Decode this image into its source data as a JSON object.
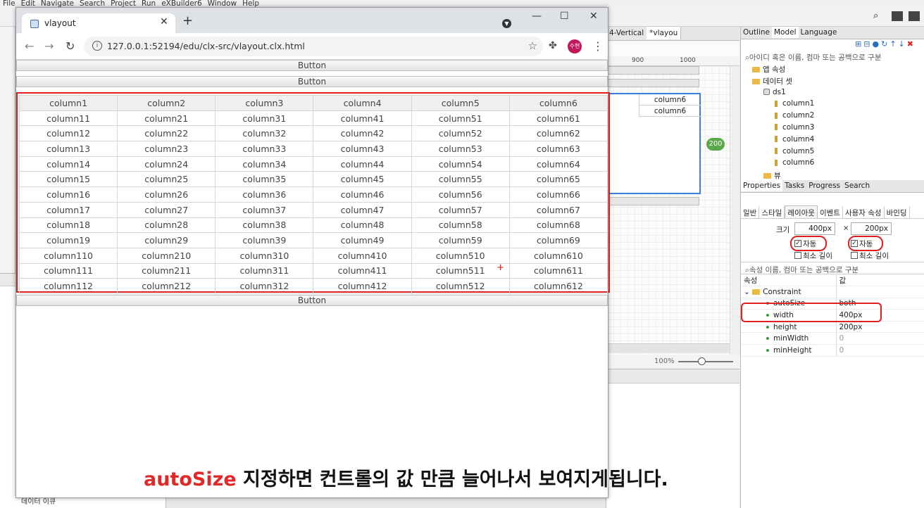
{
  "ide": {
    "menu": [
      "File",
      "Edit",
      "Navigate",
      "Search",
      "Project",
      "Run",
      "eXBuilder6",
      "Window",
      "Help"
    ],
    "editor_tabs": [
      "4-Vertical",
      "*vlayou"
    ],
    "ruler": [
      "900",
      "1000"
    ],
    "design_cells": [
      "column6",
      "column6"
    ],
    "size_badge": "200",
    "zoom": "100%",
    "left_panel_items": [
      "데이터 이큐"
    ],
    "right_top": {
      "tabs": [
        "Outline",
        "Model",
        "Language"
      ],
      "search_placeholder": "아이디 혹은 이름, 컴마 또는 공백으로 구분",
      "tree": [
        {
          "label": "앱 속성",
          "indent": 1,
          "kind": "folder"
        },
        {
          "label": "데이터 셋",
          "indent": 1,
          "kind": "folder"
        },
        {
          "label": "ds1",
          "indent": 2,
          "kind": "ds"
        },
        {
          "label": "column1",
          "indent": 3,
          "kind": "leaf"
        },
        {
          "label": "column2",
          "indent": 3,
          "kind": "leaf"
        },
        {
          "label": "column3",
          "indent": 3,
          "kind": "leaf"
        },
        {
          "label": "column4",
          "indent": 3,
          "kind": "leaf"
        },
        {
          "label": "column5",
          "indent": 3,
          "kind": "leaf"
        },
        {
          "label": "column6",
          "indent": 3,
          "kind": "leaf"
        },
        {
          "label": "뷰",
          "indent": 2,
          "kind": "folder"
        }
      ]
    },
    "properties": {
      "tabs": [
        "Properties",
        "Tasks",
        "Progress",
        "Search"
      ],
      "subtabs": [
        "일반",
        "스타일",
        "레이아웃",
        "이벤트",
        "사용자 속성",
        "바인딩"
      ],
      "size_label": "크기",
      "width_value": "400px",
      "times": "×",
      "height_value": "200px",
      "auto_label": "자동",
      "min_label_w": "최소 길이",
      "min_label_h": "최소 길이",
      "search_placeholder": "속성 이름, 컴마 또는 공백으로 구분",
      "col_name": "속성",
      "col_value": "값",
      "group": "Constraint",
      "rows": [
        {
          "name": "autoSize",
          "value": "both"
        },
        {
          "name": "width",
          "value": "400px"
        },
        {
          "name": "height",
          "value": "200px"
        },
        {
          "name": "minWidth",
          "value": "0"
        },
        {
          "name": "minHeight",
          "value": "0"
        }
      ]
    }
  },
  "browser": {
    "tab_title": "vlayout",
    "url": "127.0.0.1:52194/edu/clx-src/vlayout.clx.html",
    "avatar_text": "수현",
    "buttons": {
      "top1": "Button",
      "top2": "Button",
      "bottom": "Button"
    },
    "grid": {
      "headers": [
        "column1",
        "column2",
        "column3",
        "column4",
        "column5",
        "column6"
      ],
      "rows": [
        [
          "column11",
          "column21",
          "column31",
          "column41",
          "column51",
          "column61"
        ],
        [
          "column12",
          "column22",
          "column32",
          "column42",
          "column52",
          "column62"
        ],
        [
          "column13",
          "column23",
          "column33",
          "column43",
          "column53",
          "column63"
        ],
        [
          "column14",
          "column24",
          "column34",
          "column44",
          "column54",
          "column64"
        ],
        [
          "column15",
          "column25",
          "column35",
          "column45",
          "column55",
          "column65"
        ],
        [
          "column16",
          "column26",
          "column36",
          "column46",
          "column56",
          "column66"
        ],
        [
          "column17",
          "column27",
          "column37",
          "column47",
          "column57",
          "column67"
        ],
        [
          "column18",
          "column28",
          "column38",
          "column48",
          "column58",
          "column68"
        ],
        [
          "column19",
          "column29",
          "column39",
          "column49",
          "column59",
          "column69"
        ],
        [
          "column110",
          "column210",
          "column310",
          "column410",
          "column510",
          "column610"
        ],
        [
          "column111",
          "column211",
          "column311",
          "column411",
          "column511",
          "column611"
        ],
        [
          "column112",
          "column212",
          "column312",
          "column412",
          "column512",
          "column612"
        ]
      ]
    }
  },
  "caption": {
    "keyword": "autoSize",
    "text": " 지정하면 컨트롤의 값 만큼 늘어나서 보여지게됩니다."
  }
}
